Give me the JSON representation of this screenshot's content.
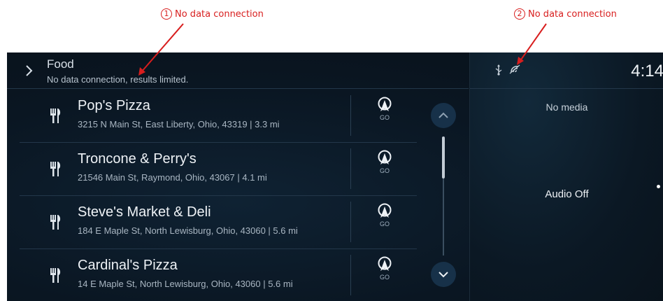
{
  "annotations": [
    {
      "number": "1",
      "text": "No data connection"
    },
    {
      "number": "2",
      "text": "No data connection"
    }
  ],
  "header": {
    "title": "Food",
    "subtitle": "No data connection, results limited."
  },
  "results": [
    {
      "name": "Pop's Pizza",
      "address": "3215 N Main St, East Liberty, Ohio, 43319 | 3.3 mi",
      "go_label": "GO"
    },
    {
      "name": "Troncone & Perry's",
      "address": "21546 Main St, Raymond, Ohio, 43067 | 4.1 mi",
      "go_label": "GO"
    },
    {
      "name": "Steve's Market & Deli",
      "address": "184 E Maple St, North Lewisburg, Ohio, 43060 | 5.6 mi",
      "go_label": "GO"
    },
    {
      "name": "Cardinal's Pizza",
      "address": "14 E Maple St, North Lewisburg, Ohio, 43060 | 5.6 mi",
      "go_label": "GO"
    }
  ],
  "status": {
    "clock": "4:14",
    "icons": [
      "usb-icon",
      "no-data-connection-icon"
    ]
  },
  "media": {
    "status": "No media",
    "audio": "Audio Off"
  },
  "colors": {
    "annotation": "#d81e1e",
    "screen_bg": "#0a1622",
    "text_primary": "#eef2f6",
    "text_secondary": "#a9b6c2",
    "scroll_button": "#173149"
  }
}
